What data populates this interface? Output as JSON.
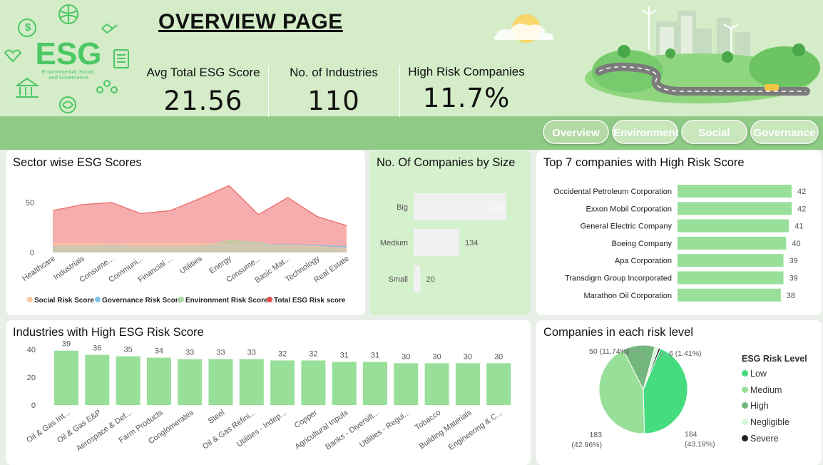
{
  "header": {
    "logo_text": "ESG",
    "logo_subtitle": "Environmental, Social, and Governance",
    "title": "OVERVIEW PAGE"
  },
  "kpis": [
    {
      "label": "Avg Total ESG Score",
      "value": "21.56"
    },
    {
      "label": "No. of Industries",
      "value": "110"
    },
    {
      "label": "High Risk Companies",
      "value": "11.7%"
    }
  ],
  "nav": [
    "Overview",
    "Environment",
    "Social",
    "Governance"
  ],
  "sector_panel": {
    "title": "Sector wise ESG Scores",
    "legend": [
      {
        "name": "Social Risk Score",
        "color": "#f8c9a0"
      },
      {
        "name": "Governance Risk Score",
        "color": "#7cc3ea"
      },
      {
        "name": "Environment Risk Score",
        "color": "#a9d8a2"
      },
      {
        "name": "Total ESG Risk score",
        "color": "#e84a4a"
      }
    ]
  },
  "size_panel": {
    "title": "No. Of Companies by Size"
  },
  "top7_panel": {
    "title": "Top 7 companies with High Risk Score"
  },
  "industries_panel": {
    "title": "Industries with High ESG Risk Score"
  },
  "risk_panel": {
    "title": "Companies in each risk level",
    "legend_title": "ESG Risk Level"
  },
  "colors": {
    "bar_green": "#98df99",
    "pie_low": "#44dc7e",
    "pie_medium": "#98df99",
    "pie_high": "#73b77d",
    "pie_negligible": "#d5f5d8",
    "pie_severe": "#222222"
  },
  "chart_data": [
    {
      "type": "area",
      "title": "Sector wise ESG Scores",
      "categories": [
        "Healthcare",
        "Industrials",
        "Consume...",
        "Communi...",
        "Financial ...",
        "Utilities",
        "Energy",
        "Consume...",
        "Basic Mat...",
        "Technology",
        "Real Estate"
      ],
      "series": [
        {
          "name": "Social Risk Score",
          "values": [
            9,
            9,
            9,
            9,
            9,
            9,
            8,
            8,
            7,
            6,
            4
          ]
        },
        {
          "name": "Governance Risk Score",
          "values": [
            6,
            6,
            7,
            6,
            6,
            6,
            8,
            8,
            8,
            7,
            6
          ]
        },
        {
          "name": "Environment Risk Score",
          "values": [
            5,
            5,
            5,
            4,
            4,
            5,
            12,
            10,
            4,
            5,
            4
          ]
        },
        {
          "name": "Total ESG Risk score",
          "values": [
            42,
            48,
            50,
            39,
            42,
            54,
            67,
            38,
            55,
            36,
            27
          ]
        }
      ],
      "yticks": [
        0,
        50
      ],
      "ylim": [
        0,
        70
      ],
      "legend": "bottom"
    },
    {
      "type": "bar",
      "title": "No. Of Companies by Size",
      "categories": [
        "Big",
        "Medium",
        "Small"
      ],
      "values": [
        272,
        134,
        20
      ],
      "orientation": "horizontal"
    },
    {
      "type": "bar",
      "title": "Top 7 companies with High Risk Score",
      "categories": [
        "Occidental Petroleum Corporation",
        "Exxon Mobil Corporation",
        "General Electric Company",
        "Boeing Company",
        "Apa Corporation",
        "Transdigm Group Incorporated",
        "Marathon Oil Corporation"
      ],
      "values": [
        42,
        42,
        41,
        40,
        39,
        39,
        38
      ],
      "orientation": "horizontal"
    },
    {
      "type": "bar",
      "title": "Industries with High ESG Risk Score",
      "categories": [
        "Oil & Gas Int...",
        "Oil & Gas E&P",
        "Aerospace & Def...",
        "Farm Products",
        "Conglomerates",
        "Steel",
        "Oil & Gas Refini...",
        "Utilities - Indep...",
        "Copper",
        "Agricultural Inputs",
        "Banks - Diversifi...",
        "Utilities - Regul...",
        "Tobacco",
        "Building Materials",
        "Engineering & C..."
      ],
      "values": [
        39,
        36,
        35,
        34,
        33,
        33,
        33,
        32,
        32,
        31,
        31,
        30,
        30,
        30,
        30
      ],
      "yticks": [
        0,
        20,
        40
      ],
      "ylim": [
        0,
        45
      ]
    },
    {
      "type": "pie",
      "title": "Companies in each risk level",
      "legend_title": "ESG Risk Level",
      "categories": [
        "Low",
        "Medium",
        "High",
        "Negligible",
        "Severe"
      ],
      "values": [
        184,
        183,
        50,
        6,
        3
      ],
      "labels": [
        {
          "count": "184",
          "pct": "(43.19%)"
        },
        {
          "count": "183",
          "pct": "(42.96%)"
        },
        {
          "count": "50 (11.74%)",
          "pct": ""
        },
        {
          "count": "6 (1.41%)",
          "pct": ""
        }
      ],
      "legend": "right"
    }
  ]
}
